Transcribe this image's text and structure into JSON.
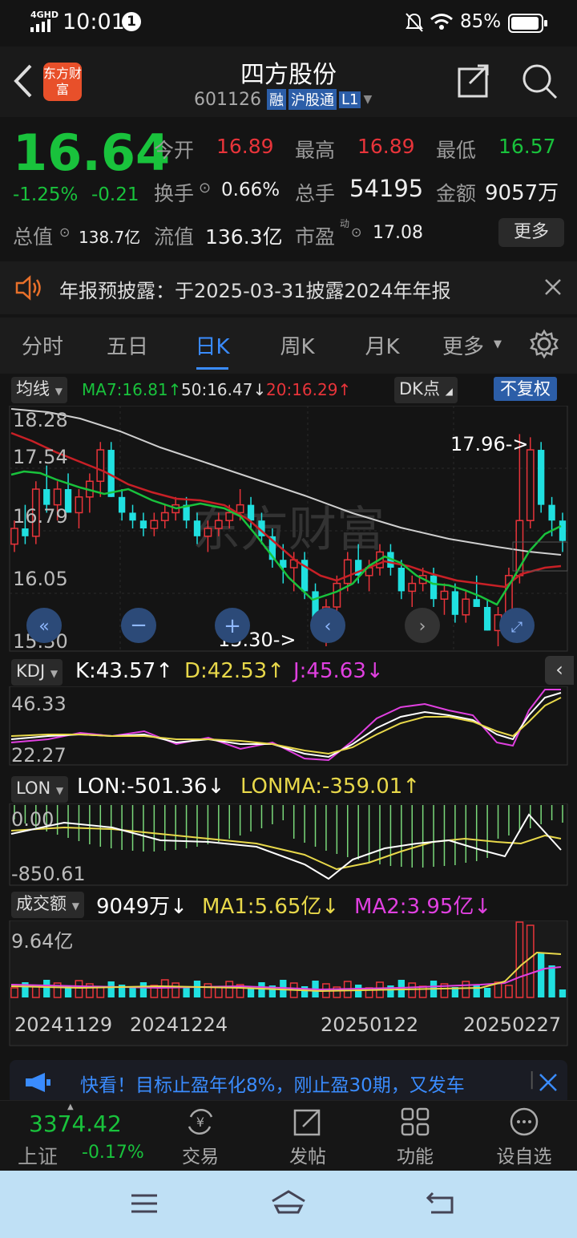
{
  "status": {
    "network": "4GHD",
    "time": "10:01",
    "notif_count": "1",
    "battery": "85%"
  },
  "header": {
    "name": "四方股份",
    "code": "601126",
    "tags": [
      "融",
      "沪股通",
      "L1"
    ],
    "logo_text": "东方财富"
  },
  "quote": {
    "price": "16.64",
    "change_pct": "-1.25%",
    "change": "-0.21",
    "open_label": "今开",
    "open": "16.89",
    "high_label": "最高",
    "high": "16.89",
    "low_label": "最低",
    "low": "16.57",
    "turnover_label": "换手",
    "turnover": "0.66%",
    "volume_label": "总手",
    "volume": "54195",
    "amount_label": "金额",
    "amount": "9057万",
    "mktcap_label": "总值",
    "mktcap": "138.7亿",
    "float_label": "流值",
    "float_cap": "136.3亿",
    "pe_label": "市盈",
    "pe_sup": "动",
    "pe": "17.08",
    "more_label": "更多"
  },
  "notice": {
    "text": "年报预披露：于2025-03-31披露2024年年报"
  },
  "tabs": [
    {
      "label": "分时",
      "active": false
    },
    {
      "label": "五日",
      "active": false
    },
    {
      "label": "日K",
      "active": true
    },
    {
      "label": "周K",
      "active": false
    },
    {
      "label": "月K",
      "active": false
    },
    {
      "label": "更多",
      "active": false
    }
  ],
  "kline": {
    "selector": "均线",
    "ma7": "MA7:16.81↑",
    "ma50": "50:16.47↓",
    "ma20": "20:16.29↑",
    "dk_label": "DK点",
    "fq_label": "不复权",
    "y_ticks": [
      "18.28",
      "17.54",
      "16.79",
      "16.05",
      "15.30"
    ],
    "annot_high": "17.96->",
    "annot_low": "15.30->",
    "watermark": "东方财富"
  },
  "kdj": {
    "label": "KDJ",
    "k": "K:43.57↑",
    "d": "D:42.53↑",
    "j": "J:45.63↓",
    "y_top": "46.33",
    "y_bottom": "22.27"
  },
  "lon": {
    "label": "LON",
    "lon": "LON:-501.36↓",
    "lonma": "LONMA:-359.01↑",
    "y_top": "0.00",
    "y_bottom": "-850.61"
  },
  "vol": {
    "label": "成交额",
    "value": "9049万↓",
    "ma1": "MA1:5.65亿↓",
    "ma2": "MA2:3.95亿↓",
    "y_top": "9.64亿"
  },
  "dates": [
    "20241129",
    "20241224",
    "20250122",
    "20250227"
  ],
  "ad": {
    "text": "快看！目标止盈年化8%，刚止盈30期，又发车"
  },
  "index": {
    "value": "3374.42",
    "name": "上证",
    "change": "-0.17%"
  },
  "bottomnav": [
    {
      "label": "交易",
      "icon": "yen-cycle-icon"
    },
    {
      "label": "发帖",
      "icon": "edit-icon"
    },
    {
      "label": "功能",
      "icon": "grid-icon"
    },
    {
      "label": "设自选",
      "icon": "more-dots-icon"
    }
  ],
  "colors": {
    "up": "#e8343a",
    "down": "#19c23c",
    "accent": "#3a8cff",
    "cyan": "#20e0e0",
    "yellow": "#e8d84a",
    "magenta": "#e040e0"
  },
  "chart_data": {
    "type": "candlestick",
    "ylim": [
      15.3,
      18.28
    ],
    "candles": [
      [
        16.6,
        16.9,
        16.5,
        16.8
      ],
      [
        16.8,
        17.1,
        16.6,
        16.7
      ],
      [
        16.7,
        17.4,
        16.6,
        17.3
      ],
      [
        17.3,
        17.6,
        17.0,
        17.1
      ],
      [
        17.1,
        17.4,
        16.9,
        17.3
      ],
      [
        17.3,
        17.5,
        17.0,
        17.0
      ],
      [
        17.0,
        17.3,
        16.8,
        17.2
      ],
      [
        17.2,
        17.5,
        17.0,
        17.4
      ],
      [
        17.4,
        17.9,
        17.2,
        17.8
      ],
      [
        17.8,
        17.9,
        17.2,
        17.2
      ],
      [
        17.2,
        17.3,
        16.9,
        17.0
      ],
      [
        17.0,
        17.1,
        16.8,
        16.9
      ],
      [
        16.9,
        17.0,
        16.7,
        16.8
      ],
      [
        16.8,
        17.0,
        16.7,
        16.9
      ],
      [
        16.9,
        17.1,
        16.8,
        17.0
      ],
      [
        17.0,
        17.2,
        16.9,
        17.1
      ],
      [
        17.1,
        17.2,
        16.8,
        16.9
      ],
      [
        16.9,
        17.0,
        16.6,
        16.7
      ],
      [
        16.7,
        16.9,
        16.5,
        16.8
      ],
      [
        16.8,
        17.0,
        16.7,
        16.9
      ],
      [
        16.9,
        17.1,
        16.8,
        17.0
      ],
      [
        17.0,
        17.3,
        16.9,
        17.1
      ],
      [
        17.1,
        17.2,
        16.8,
        16.9
      ],
      [
        16.9,
        17.0,
        16.6,
        16.7
      ],
      [
        16.7,
        16.8,
        16.3,
        16.4
      ],
      [
        16.4,
        16.6,
        16.1,
        16.3
      ],
      [
        16.3,
        16.5,
        16.0,
        16.4
      ],
      [
        16.4,
        16.5,
        15.9,
        16.0
      ],
      [
        16.0,
        16.1,
        15.5,
        15.6
      ],
      [
        15.6,
        15.9,
        15.3,
        15.8
      ],
      [
        15.8,
        16.2,
        15.7,
        16.1
      ],
      [
        16.1,
        16.5,
        16.0,
        16.4
      ],
      [
        16.4,
        16.6,
        16.1,
        16.2
      ],
      [
        16.2,
        16.4,
        16.0,
        16.3
      ],
      [
        16.3,
        16.6,
        16.2,
        16.5
      ],
      [
        16.5,
        16.6,
        16.2,
        16.3
      ],
      [
        16.3,
        16.4,
        15.9,
        16.0
      ],
      [
        16.0,
        16.2,
        15.8,
        16.1
      ],
      [
        16.1,
        16.3,
        16.0,
        16.2
      ],
      [
        16.2,
        16.3,
        15.8,
        15.9
      ],
      [
        15.9,
        16.1,
        15.7,
        16.0
      ],
      [
        16.0,
        16.1,
        15.6,
        15.7
      ],
      [
        15.7,
        16.0,
        15.6,
        15.9
      ],
      [
        15.9,
        16.2,
        15.8,
        15.8
      ],
      [
        15.8,
        15.9,
        15.5,
        15.5
      ],
      [
        15.5,
        15.8,
        15.3,
        15.7
      ],
      [
        15.7,
        16.3,
        15.6,
        16.2
      ],
      [
        16.2,
        18.0,
        16.1,
        16.9
      ],
      [
        16.9,
        17.96,
        16.8,
        17.8
      ],
      [
        17.8,
        17.9,
        17.0,
        17.1
      ],
      [
        17.1,
        17.2,
        16.7,
        16.9
      ],
      [
        16.9,
        17.0,
        16.5,
        16.64
      ]
    ]
  }
}
